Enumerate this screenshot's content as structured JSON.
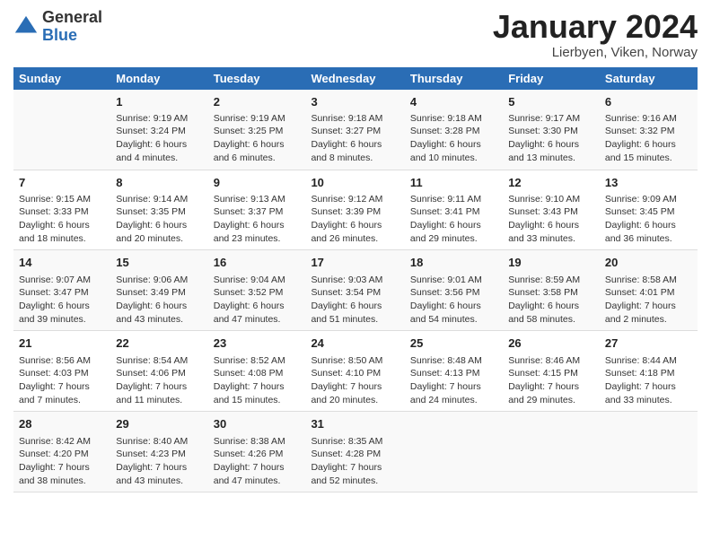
{
  "logo": {
    "general": "General",
    "blue": "Blue"
  },
  "title": "January 2024",
  "subtitle": "Lierbyen, Viken, Norway",
  "weekdays": [
    "Sunday",
    "Monday",
    "Tuesday",
    "Wednesday",
    "Thursday",
    "Friday",
    "Saturday"
  ],
  "weeks": [
    [
      {
        "day": "",
        "sunrise": "",
        "sunset": "",
        "daylight": ""
      },
      {
        "day": "1",
        "sunrise": "Sunrise: 9:19 AM",
        "sunset": "Sunset: 3:24 PM",
        "daylight": "Daylight: 6 hours and 4 minutes."
      },
      {
        "day": "2",
        "sunrise": "Sunrise: 9:19 AM",
        "sunset": "Sunset: 3:25 PM",
        "daylight": "Daylight: 6 hours and 6 minutes."
      },
      {
        "day": "3",
        "sunrise": "Sunrise: 9:18 AM",
        "sunset": "Sunset: 3:27 PM",
        "daylight": "Daylight: 6 hours and 8 minutes."
      },
      {
        "day": "4",
        "sunrise": "Sunrise: 9:18 AM",
        "sunset": "Sunset: 3:28 PM",
        "daylight": "Daylight: 6 hours and 10 minutes."
      },
      {
        "day": "5",
        "sunrise": "Sunrise: 9:17 AM",
        "sunset": "Sunset: 3:30 PM",
        "daylight": "Daylight: 6 hours and 13 minutes."
      },
      {
        "day": "6",
        "sunrise": "Sunrise: 9:16 AM",
        "sunset": "Sunset: 3:32 PM",
        "daylight": "Daylight: 6 hours and 15 minutes."
      }
    ],
    [
      {
        "day": "7",
        "sunrise": "Sunrise: 9:15 AM",
        "sunset": "Sunset: 3:33 PM",
        "daylight": "Daylight: 6 hours and 18 minutes."
      },
      {
        "day": "8",
        "sunrise": "Sunrise: 9:14 AM",
        "sunset": "Sunset: 3:35 PM",
        "daylight": "Daylight: 6 hours and 20 minutes."
      },
      {
        "day": "9",
        "sunrise": "Sunrise: 9:13 AM",
        "sunset": "Sunset: 3:37 PM",
        "daylight": "Daylight: 6 hours and 23 minutes."
      },
      {
        "day": "10",
        "sunrise": "Sunrise: 9:12 AM",
        "sunset": "Sunset: 3:39 PM",
        "daylight": "Daylight: 6 hours and 26 minutes."
      },
      {
        "day": "11",
        "sunrise": "Sunrise: 9:11 AM",
        "sunset": "Sunset: 3:41 PM",
        "daylight": "Daylight: 6 hours and 29 minutes."
      },
      {
        "day": "12",
        "sunrise": "Sunrise: 9:10 AM",
        "sunset": "Sunset: 3:43 PM",
        "daylight": "Daylight: 6 hours and 33 minutes."
      },
      {
        "day": "13",
        "sunrise": "Sunrise: 9:09 AM",
        "sunset": "Sunset: 3:45 PM",
        "daylight": "Daylight: 6 hours and 36 minutes."
      }
    ],
    [
      {
        "day": "14",
        "sunrise": "Sunrise: 9:07 AM",
        "sunset": "Sunset: 3:47 PM",
        "daylight": "Daylight: 6 hours and 39 minutes."
      },
      {
        "day": "15",
        "sunrise": "Sunrise: 9:06 AM",
        "sunset": "Sunset: 3:49 PM",
        "daylight": "Daylight: 6 hours and 43 minutes."
      },
      {
        "day": "16",
        "sunrise": "Sunrise: 9:04 AM",
        "sunset": "Sunset: 3:52 PM",
        "daylight": "Daylight: 6 hours and 47 minutes."
      },
      {
        "day": "17",
        "sunrise": "Sunrise: 9:03 AM",
        "sunset": "Sunset: 3:54 PM",
        "daylight": "Daylight: 6 hours and 51 minutes."
      },
      {
        "day": "18",
        "sunrise": "Sunrise: 9:01 AM",
        "sunset": "Sunset: 3:56 PM",
        "daylight": "Daylight: 6 hours and 54 minutes."
      },
      {
        "day": "19",
        "sunrise": "Sunrise: 8:59 AM",
        "sunset": "Sunset: 3:58 PM",
        "daylight": "Daylight: 6 hours and 58 minutes."
      },
      {
        "day": "20",
        "sunrise": "Sunrise: 8:58 AM",
        "sunset": "Sunset: 4:01 PM",
        "daylight": "Daylight: 7 hours and 2 minutes."
      }
    ],
    [
      {
        "day": "21",
        "sunrise": "Sunrise: 8:56 AM",
        "sunset": "Sunset: 4:03 PM",
        "daylight": "Daylight: 7 hours and 7 minutes."
      },
      {
        "day": "22",
        "sunrise": "Sunrise: 8:54 AM",
        "sunset": "Sunset: 4:06 PM",
        "daylight": "Daylight: 7 hours and 11 minutes."
      },
      {
        "day": "23",
        "sunrise": "Sunrise: 8:52 AM",
        "sunset": "Sunset: 4:08 PM",
        "daylight": "Daylight: 7 hours and 15 minutes."
      },
      {
        "day": "24",
        "sunrise": "Sunrise: 8:50 AM",
        "sunset": "Sunset: 4:10 PM",
        "daylight": "Daylight: 7 hours and 20 minutes."
      },
      {
        "day": "25",
        "sunrise": "Sunrise: 8:48 AM",
        "sunset": "Sunset: 4:13 PM",
        "daylight": "Daylight: 7 hours and 24 minutes."
      },
      {
        "day": "26",
        "sunrise": "Sunrise: 8:46 AM",
        "sunset": "Sunset: 4:15 PM",
        "daylight": "Daylight: 7 hours and 29 minutes."
      },
      {
        "day": "27",
        "sunrise": "Sunrise: 8:44 AM",
        "sunset": "Sunset: 4:18 PM",
        "daylight": "Daylight: 7 hours and 33 minutes."
      }
    ],
    [
      {
        "day": "28",
        "sunrise": "Sunrise: 8:42 AM",
        "sunset": "Sunset: 4:20 PM",
        "daylight": "Daylight: 7 hours and 38 minutes."
      },
      {
        "day": "29",
        "sunrise": "Sunrise: 8:40 AM",
        "sunset": "Sunset: 4:23 PM",
        "daylight": "Daylight: 7 hours and 43 minutes."
      },
      {
        "day": "30",
        "sunrise": "Sunrise: 8:38 AM",
        "sunset": "Sunset: 4:26 PM",
        "daylight": "Daylight: 7 hours and 47 minutes."
      },
      {
        "day": "31",
        "sunrise": "Sunrise: 8:35 AM",
        "sunset": "Sunset: 4:28 PM",
        "daylight": "Daylight: 7 hours and 52 minutes."
      },
      {
        "day": "",
        "sunrise": "",
        "sunset": "",
        "daylight": ""
      },
      {
        "day": "",
        "sunrise": "",
        "sunset": "",
        "daylight": ""
      },
      {
        "day": "",
        "sunrise": "",
        "sunset": "",
        "daylight": ""
      }
    ]
  ]
}
